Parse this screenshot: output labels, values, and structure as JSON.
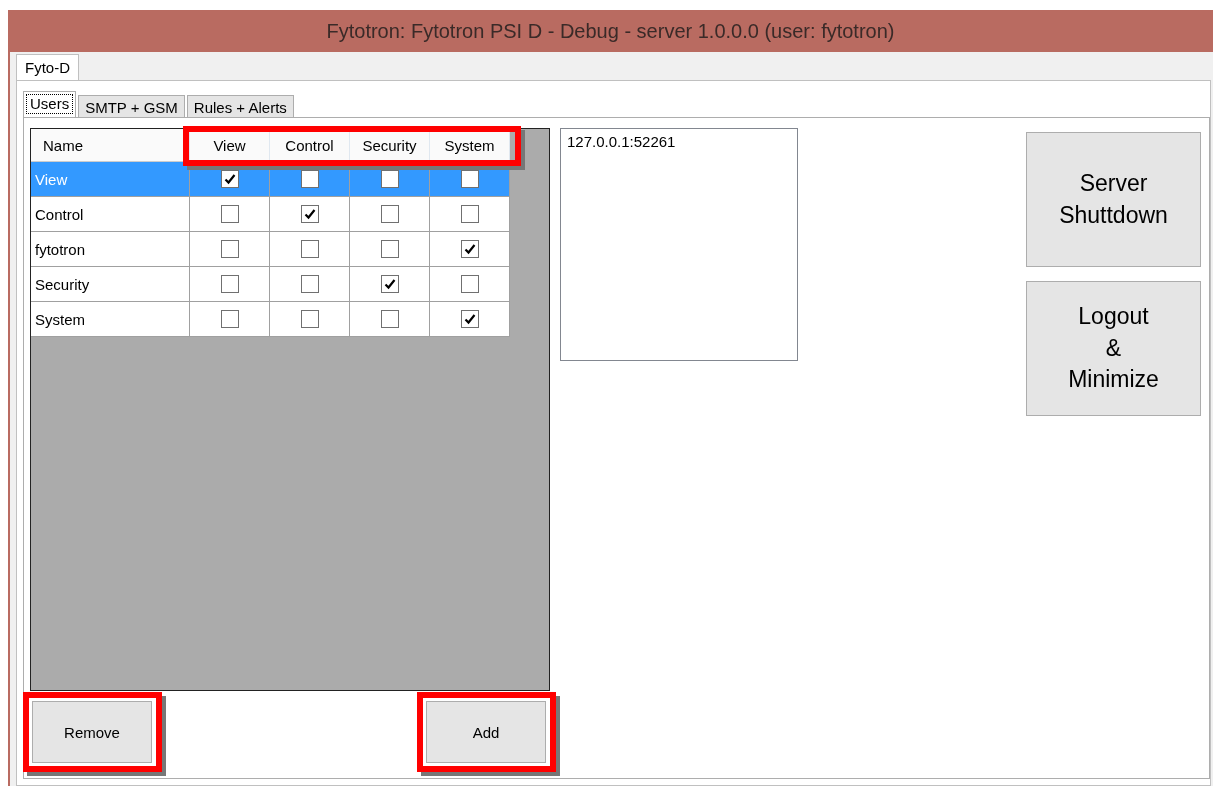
{
  "window": {
    "title": "Fytotron: Fytotron PSI D - Debug - server  1.0.0.0 (user: fytotron)"
  },
  "outer_tabs": [
    {
      "label": "Fyto-D",
      "selected": true
    }
  ],
  "tabs": [
    {
      "label": "Users",
      "selected": true
    },
    {
      "label": "SMTP + GSM",
      "selected": false
    },
    {
      "label": "Rules + Alerts",
      "selected": false
    }
  ],
  "grid": {
    "name_column": "Name",
    "permission_columns": [
      "View",
      "Control",
      "Security",
      "System"
    ],
    "columns_highlighted": true,
    "rows": [
      {
        "name": "View",
        "selected": true,
        "permissions": [
          true,
          false,
          false,
          false
        ]
      },
      {
        "name": "Control",
        "selected": false,
        "permissions": [
          false,
          true,
          false,
          false
        ]
      },
      {
        "name": "fytotron",
        "selected": false,
        "permissions": [
          false,
          false,
          false,
          true
        ]
      },
      {
        "name": "Security",
        "selected": false,
        "permissions": [
          false,
          false,
          true,
          false
        ]
      },
      {
        "name": "System",
        "selected": false,
        "permissions": [
          false,
          false,
          false,
          true
        ]
      }
    ]
  },
  "grid_buttons": [
    {
      "label": "Remove",
      "highlighted": true
    },
    {
      "label": "Add",
      "highlighted": true
    }
  ],
  "connections": [
    "127.0.0.1:52261"
  ],
  "side_buttons": [
    {
      "lines": [
        "Server",
        "Shuttdown"
      ]
    },
    {
      "lines": [
        "Logout",
        "&",
        "Minimize"
      ]
    }
  ]
}
